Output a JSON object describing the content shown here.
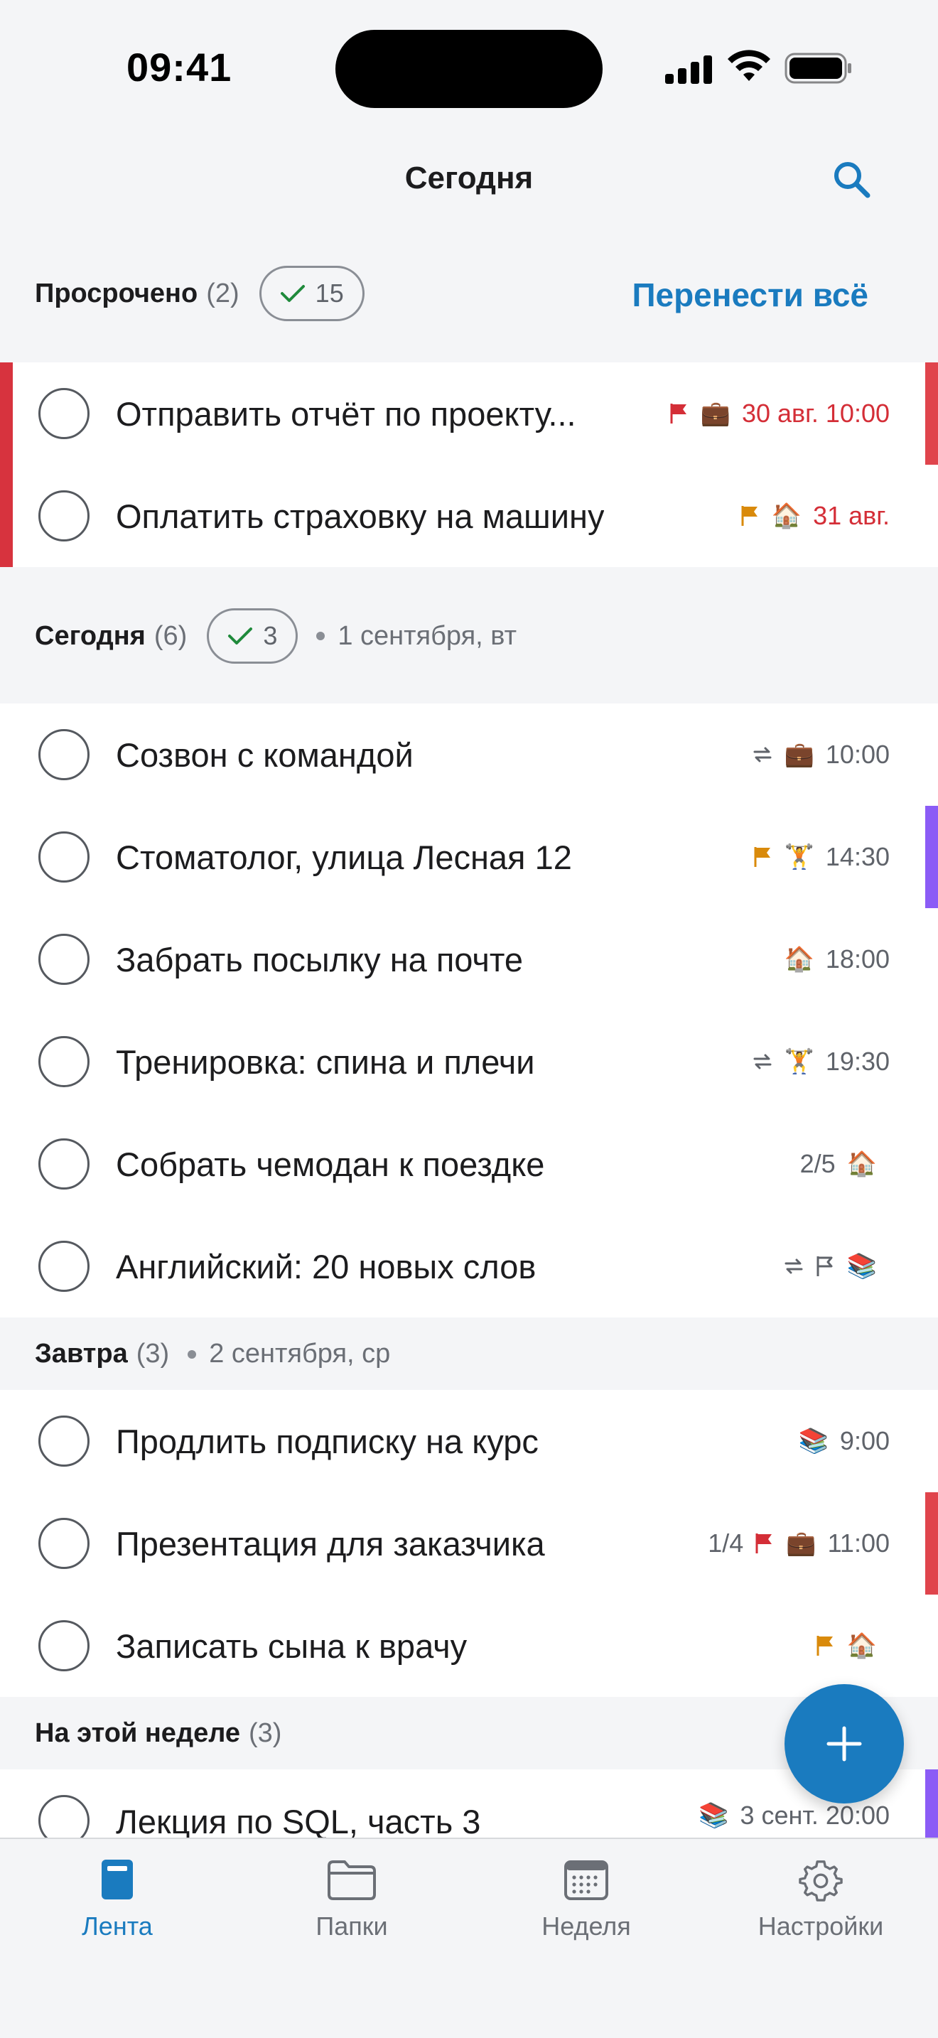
{
  "status_bar": {
    "time": "09:41"
  },
  "nav": {
    "title": "Сегодня"
  },
  "overdue": {
    "title": "Просрочено",
    "count": "(2)",
    "done_count": "15",
    "action": "Перенести всё",
    "tasks": [
      {
        "text": "Отправить отчёт по проекту...",
        "icons": [
          "flag-red-icon",
          "briefcase-icon"
        ],
        "due": "30 авг. 10:00"
      },
      {
        "text": "Оплатить страховку на машину",
        "icons": [
          "flag-orange-icon",
          "house-icon"
        ],
        "due": "31 авг."
      }
    ]
  },
  "today": {
    "title": "Сегодня",
    "count": "(6)",
    "done_count": "3",
    "date": "1 сентября, вт",
    "tasks": [
      {
        "text": "Созвон с командой",
        "icons": [
          "repeat-icon",
          "briefcase-icon"
        ],
        "due": "10:00"
      },
      {
        "text": "Стоматолог, улица Лесная 12",
        "icons": [
          "flag-orange-icon",
          "weightlifter-icon"
        ],
        "due": "14:30"
      },
      {
        "text": "Забрать посылку на почте",
        "icons": [
          "house-icon"
        ],
        "due": "18:00"
      },
      {
        "text": "Тренировка: спина и плечи",
        "icons": [
          "repeat-icon",
          "weightlifter-icon"
        ],
        "due": "19:30"
      },
      {
        "text": "Собрать чемодан к поездке",
        "subtasks": "2/5",
        "icons": [
          "house-icon"
        ],
        "due": ""
      },
      {
        "text": "Английский: 20 новых слов",
        "icons": [
          "repeat-icon",
          "flag-outline-icon",
          "books-icon"
        ],
        "due": ""
      }
    ]
  },
  "tomorrow": {
    "title": "Завтра",
    "count": "(3)",
    "date": "2 сентября, ср",
    "tasks": [
      {
        "text": "Продлить подписку на курс",
        "icons": [
          "books-icon"
        ],
        "due": "9:00"
      },
      {
        "text": "Презентация для заказчика",
        "subtasks": "1/4",
        "icons": [
          "flag-red-icon",
          "briefcase-icon"
        ],
        "due": "11:00"
      },
      {
        "text": "Записать сына к врачу",
        "icons": [
          "flag-orange-icon",
          "house-icon"
        ],
        "due": ""
      }
    ]
  },
  "week": {
    "title": "На этой неделе",
    "count": "(3)",
    "tasks": [
      {
        "text": "Лекция по SQL, часть 3",
        "icons": [
          "books-icon"
        ],
        "due": "3 сент. 20:00"
      }
    ]
  },
  "tabs": [
    {
      "label": "Лента",
      "icon": "feed-icon",
      "active": true
    },
    {
      "label": "Папки",
      "icon": "folder-icon",
      "active": false
    },
    {
      "label": "Неделя",
      "icon": "calendar-icon",
      "active": false
    },
    {
      "label": "Настройки",
      "icon": "gear-icon",
      "active": false
    }
  ],
  "colors": {
    "accent": "#1a7bbf",
    "overdue_red": "#d42e37",
    "priority_red": "#e0444c",
    "priority_purple": "#8b5cf6",
    "flag_orange": "#d98a0b"
  }
}
